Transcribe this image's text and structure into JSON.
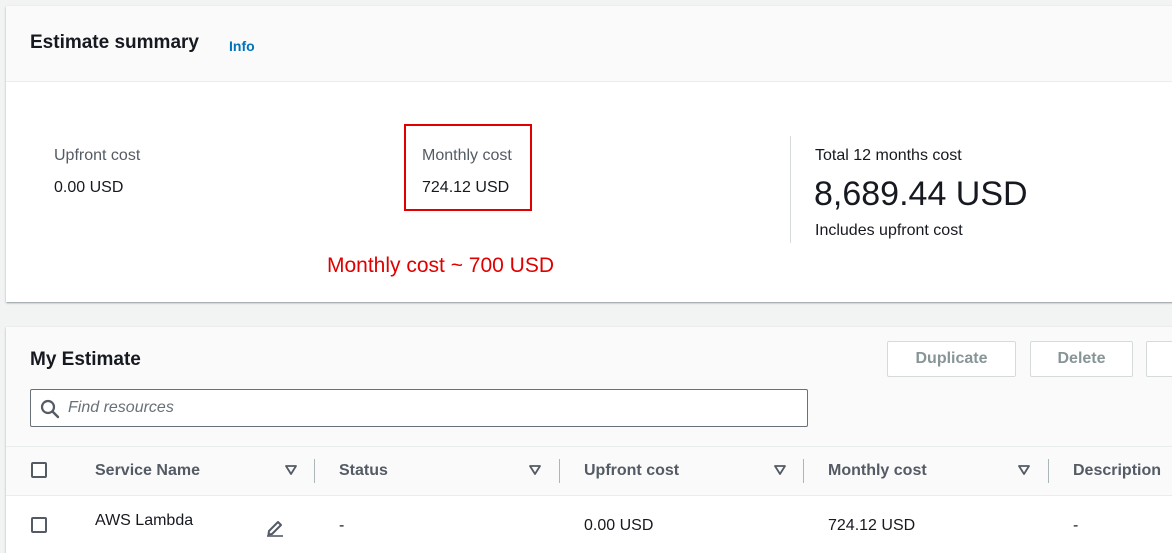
{
  "summary": {
    "title": "Estimate summary",
    "info_link": "Info",
    "upfront": {
      "label": "Upfront cost",
      "value": "0.00 USD"
    },
    "monthly": {
      "label": "Monthly cost",
      "value": "724.12 USD"
    },
    "total": {
      "label": "Total 12 months cost",
      "value": "8,689.44 USD",
      "sub": "Includes upfront cost"
    },
    "annotation": "Monthly cost ~ 700 USD",
    "highlight_color": "#e00000"
  },
  "estimate": {
    "title": "My Estimate",
    "buttons": {
      "duplicate": "Duplicate",
      "delete": "Delete"
    },
    "search": {
      "placeholder": "Find resources",
      "value": ""
    },
    "columns": {
      "service_name": "Service Name",
      "status": "Status",
      "upfront_cost": "Upfront cost",
      "monthly_cost": "Monthly cost",
      "description": "Description"
    },
    "rows": [
      {
        "service_name": "AWS Lambda",
        "status": "-",
        "upfront_cost": "0.00 USD",
        "monthly_cost": "724.12 USD",
        "description": "-",
        "icons": [
          "edit-icon"
        ]
      }
    ]
  },
  "colors": {
    "link": "#0073bb",
    "annotation_red": "#e00000",
    "disabled_text": "#879596"
  }
}
